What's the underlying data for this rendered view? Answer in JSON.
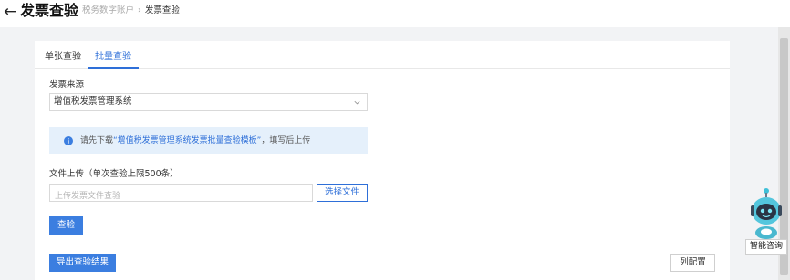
{
  "header": {
    "back_icon": "arrow-left-icon",
    "title": "发票查验",
    "breadcrumb": [
      "税务数字账户",
      "发票查验"
    ],
    "breadcrumb_separator": "›"
  },
  "tabs": [
    {
      "label": "单张查验",
      "active": false
    },
    {
      "label": "批量查验",
      "active": true
    }
  ],
  "form": {
    "source_label": "发票来源",
    "source_value": "增值税发票管理系统",
    "alert_prefix": "请先下载",
    "alert_link": "“增值税发票管理系统发票批量查验模板”",
    "alert_suffix": "，填写后上传",
    "upload_label": "文件上传（单次查验上限500条）",
    "upload_placeholder": "上传发票文件查验",
    "choose_file_button": "选择文件",
    "verify_button": "查验"
  },
  "actions": {
    "export_button": "导出查验结果",
    "columns_button": "列配置"
  },
  "assistant": {
    "label": "智能咨询",
    "icon": "robot-assistant-icon"
  },
  "colors": {
    "accent": "#2e6fd8",
    "primary_button": "#3b7ee0",
    "alert_bg": "#e5f0fb",
    "page_bg": "#f2f3f5"
  }
}
